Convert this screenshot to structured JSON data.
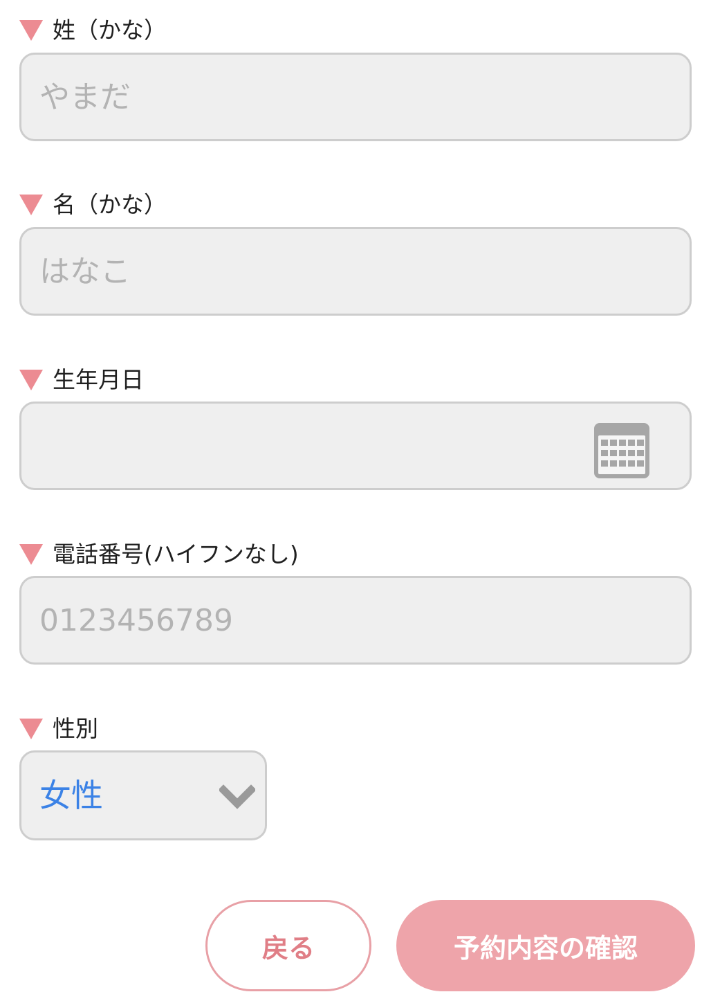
{
  "form": {
    "last_name_kana": {
      "label": "姓（かな）",
      "placeholder": "やまだ",
      "value": ""
    },
    "first_name_kana": {
      "label": "名（かな）",
      "placeholder": "はなこ",
      "value": ""
    },
    "birthdate": {
      "label": "生年月日",
      "value": "",
      "icon": "calendar-icon"
    },
    "phone": {
      "label": "電話番号(ハイフンなし)",
      "placeholder": "0123456789",
      "value": ""
    },
    "gender": {
      "label": "性別",
      "selected": "女性",
      "icon": "chevron-down-icon"
    }
  },
  "buttons": {
    "back_label": "戻る",
    "confirm_label": "予約内容の確認"
  },
  "colors": {
    "accent_pink": "#ec8b92",
    "confirm_bg": "#eea4aa",
    "select_text": "#3b82e6",
    "field_bg": "#efefef",
    "field_border": "#cdcdcd"
  }
}
